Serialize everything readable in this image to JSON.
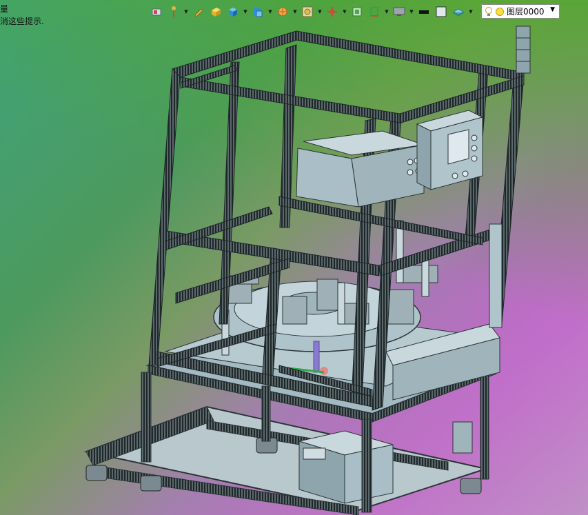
{
  "hint": {
    "line1": "量",
    "line2": "消这些提示."
  },
  "toolbar": {
    "icons": [
      {
        "name": "view-orient-icon",
        "color": "#d0473b"
      },
      {
        "name": "pin-icon",
        "color": "#e9b33a"
      },
      {
        "name": "pencil-icon",
        "color": "#e8c443"
      },
      {
        "name": "box-yellow-icon",
        "color": "#f0c63a"
      },
      {
        "name": "cube-icon",
        "color": "#2e8fd6"
      },
      {
        "name": "cube-solid-icon",
        "color": "#2e8fd6"
      },
      {
        "name": "wheel-icon",
        "color": "#e88a2a"
      },
      {
        "name": "render-icon",
        "color": "#d8c04a"
      },
      {
        "name": "axis-icon",
        "color": "#d0473b"
      },
      {
        "name": "fit-icon",
        "color": "#4aa84a"
      },
      {
        "name": "section-icon",
        "color": "#3aa04a"
      },
      {
        "name": "display-icon",
        "color": "#555555"
      },
      {
        "name": "color-swatch-black",
        "color": "#111111"
      },
      {
        "name": "color-swatch-light",
        "color": "#dfe8ee"
      },
      {
        "name": "layer-stack-icon",
        "color": "#46a8c8"
      }
    ]
  },
  "layer": {
    "name": "图层0000"
  },
  "colors": {
    "frame_dark": "#2b3436",
    "frame_light": "#b8c6cc",
    "panel": "#9fb8c2",
    "panel_light": "#c6d6dc",
    "accent_blue": "#2e8fd6"
  }
}
